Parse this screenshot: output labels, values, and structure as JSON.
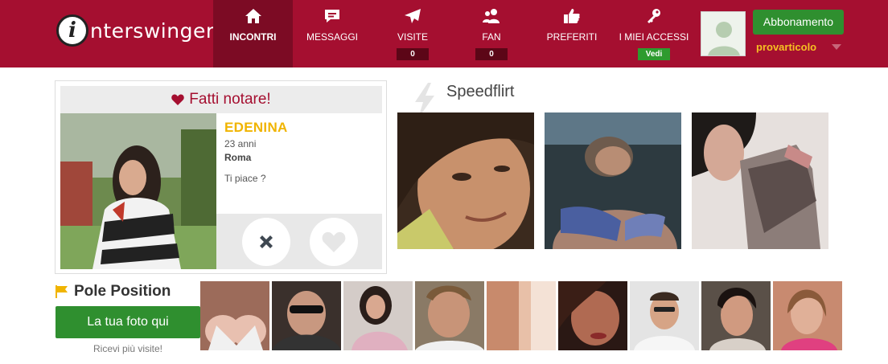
{
  "brand": {
    "logo_letter": "i",
    "logo_text": "nterswinger"
  },
  "nav": [
    {
      "label": "INCONTRI",
      "icon": "home-icon",
      "active": true,
      "badge": ""
    },
    {
      "label": "MESSAGGI",
      "icon": "chat-icon",
      "active": false,
      "badge": ""
    },
    {
      "label": "VISITE",
      "icon": "paper-plane-icon",
      "active": false,
      "badge": "0"
    },
    {
      "label": "FAN",
      "icon": "users-icon",
      "active": false,
      "badge": "0"
    },
    {
      "label": "PREFERITI",
      "icon": "thumbs-up-icon",
      "active": false,
      "badge": ""
    },
    {
      "label": "I MIEI ACCESSI",
      "icon": "key-icon",
      "active": false,
      "badge": "Vedi"
    }
  ],
  "user": {
    "subscribe_label": "Abbonamento",
    "username": "provarticolo"
  },
  "fatti": {
    "title": "Fatti notare!",
    "name": "EDENINA",
    "age": "23 anni",
    "city": "Roma",
    "question": "Ti piace ?"
  },
  "speedflirt": {
    "title": "Speedflirt"
  },
  "pole": {
    "title": "Pole Position",
    "button": "La tua foto qui",
    "subtext": "Ricevi più visite!"
  },
  "colors": {
    "brand": "#a50f30",
    "brand_dark": "#7c0b24",
    "accent_green": "#2f8f2f",
    "accent_yellow": "#f0b400"
  }
}
